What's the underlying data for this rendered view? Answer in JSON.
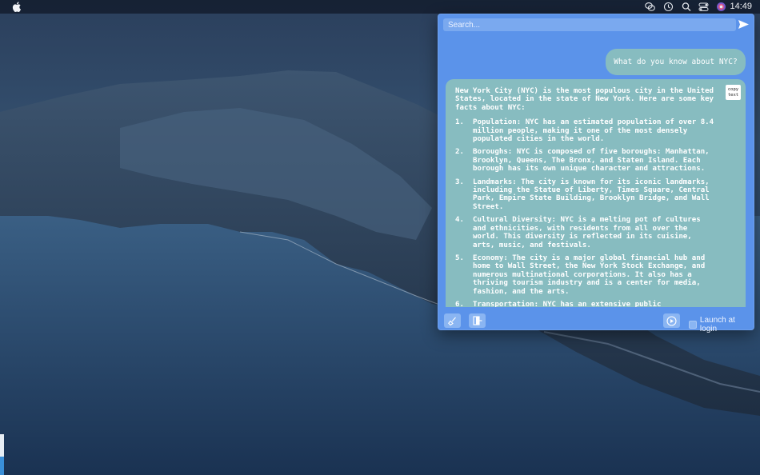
{
  "menubar": {
    "clock": "14:49",
    "icons": [
      "apple-icon",
      "chat-bubbles-icon",
      "time-machine-icon",
      "search-icon",
      "control-center-icon",
      "siri-icon"
    ]
  },
  "panel": {
    "search_placeholder": "Search...",
    "user_message": "What do you know about NYC?",
    "copy_label": "copy text",
    "response_intro": "New York City (NYC) is the most populous city in the United States, located in the state of New York. Here are some key facts about NYC:",
    "response_items": [
      {
        "num": "1.",
        "text": "Population: NYC has an estimated population of over 8.4 million people, making it one of the most densely populated cities in the world."
      },
      {
        "num": "2.",
        "text": "Boroughs: NYC is composed of five boroughs: Manhattan, Brooklyn, Queens, The Bronx, and Staten Island. Each borough has its own unique character and attractions."
      },
      {
        "num": "3.",
        "text": "Landmarks: The city is known for its iconic landmarks, including the Statue of Liberty, Times Square, Central Park, Empire State Building, Brooklyn Bridge, and Wall Street."
      },
      {
        "num": "4.",
        "text": "Cultural Diversity: NYC is a melting pot of cultures and ethnicities, with residents from all over the world. This diversity is reflected in its cuisine, arts, music, and festivals."
      },
      {
        "num": "5.",
        "text": "Economy: The city is a major global financial hub and home to Wall Street, the New York Stock Exchange, and numerous multinational corporations. It also has a thriving tourism industry and is a center for media, fashion, and the arts."
      },
      {
        "num": "6.",
        "text": "Transportation: NYC has an extensive public transportation system, including the subway, buses, and taxis. It is also"
      }
    ],
    "launch_label": "Launch at login",
    "colors": {
      "panel": "#5b93ea",
      "bubble": "#87bcc0"
    }
  }
}
